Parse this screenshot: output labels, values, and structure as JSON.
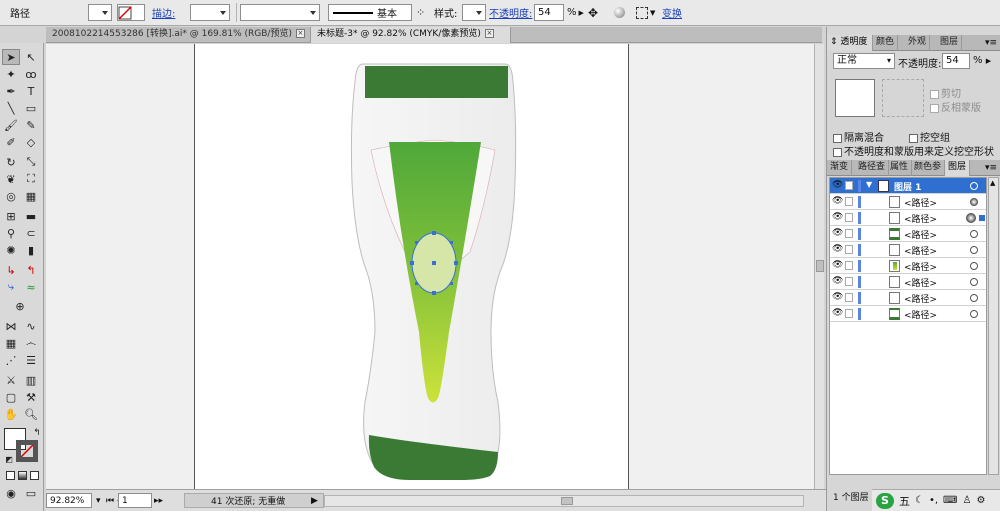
{
  "control_bar": {
    "object_type": "路径",
    "stroke_label": "描边:",
    "stroke_profile": "基本",
    "style_label": "样式:",
    "opacity_label": "不透明度:",
    "opacity_value": "54",
    "opacity_unit": "%",
    "transform_label": "变换"
  },
  "tabs": [
    {
      "label": "200810221455328​6 [转换].ai* @ 169.81% (RGB/预览)",
      "close": "×"
    },
    {
      "label": "未标题-3* @ 92.82% (CMYK/像素预览)",
      "close": "×"
    }
  ],
  "status": {
    "zoom": "92.82%",
    "artboard": "1",
    "info": "41 次还原; 无重做"
  },
  "transparency": {
    "tabs": [
      "透明度",
      "颜色",
      "外观",
      "图层"
    ],
    "mode": "正常",
    "opacity_label": "不透明度:",
    "opacity_value": "54",
    "opacity_unit": "%",
    "clip_label": "剪切",
    "invert_mask_label": "反相蒙版",
    "isolate_blending_label": "隔离混合",
    "knockout_group_label": "挖空组",
    "opacity_mask_label": "不透明度和蒙版用来定义挖空形状"
  },
  "layers": {
    "tabs": [
      "渐变",
      "路径查",
      "属性",
      "颜色参",
      "图层"
    ],
    "top_layer": "图层 1",
    "items": [
      "<路径>",
      "<路径>",
      "<路径>",
      "<路径>",
      "<路径>",
      "<路径>",
      "<路径>",
      "<路径>"
    ],
    "footer_count": "1 个图层"
  },
  "taskbar": {
    "ime_label": "五"
  },
  "colors": {
    "dark_green": "#3b7a35",
    "gradient_top": "#4fa83a",
    "gradient_bottom": "#cde23a",
    "selection_blue": "#2f6fd0"
  }
}
